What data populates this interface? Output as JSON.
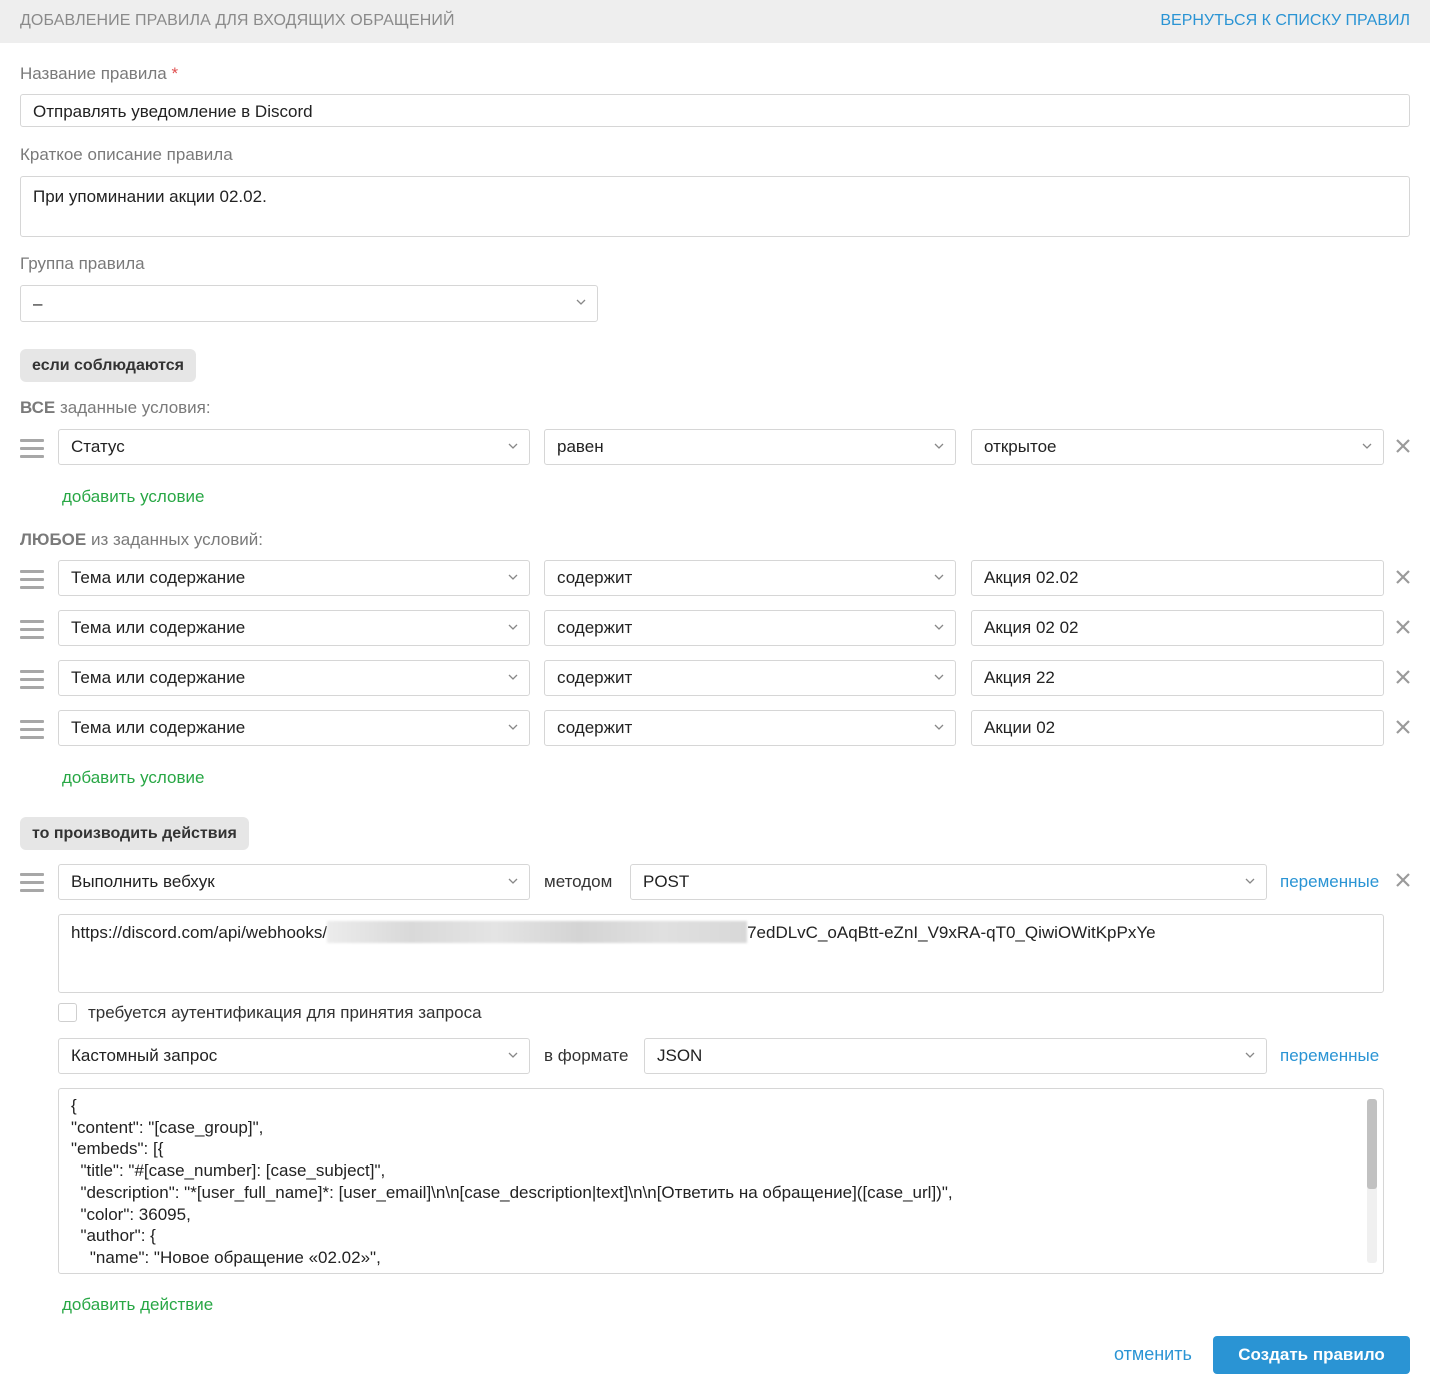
{
  "header": {
    "title": "ДОБАВЛЕНИЕ ПРАВИЛА ДЛЯ ВХОДЯЩИХ ОБРАЩЕНИЙ",
    "back_link": "ВЕРНУТЬСЯ К СПИСКУ ПРАВИЛ"
  },
  "form": {
    "name_label": "Название правила",
    "name_required_mark": "*",
    "name_value": "Отправлять уведомление в Discord",
    "description_label": "Краткое описание правила",
    "description_value": "При упоминании акции 02.02.",
    "group_label": "Группа правила",
    "group_value": "–"
  },
  "conditions": {
    "if_pill": "если соблюдаются",
    "all_title_bold": "ВСЕ",
    "all_title_rest": " заданные условия:",
    "all_rows": [
      {
        "field": "Статус",
        "operator": "равен",
        "value": "открытое"
      }
    ],
    "add_condition": "добавить условие",
    "any_title_bold": "ЛЮБОЕ",
    "any_title_rest": " из заданных условий:",
    "any_rows": [
      {
        "field": "Тема или содержание",
        "operator": "содержит",
        "value": "Акция 02.02"
      },
      {
        "field": "Тема или содержание",
        "operator": "содержит",
        "value": "Акция 02 02"
      },
      {
        "field": "Тема или содержание",
        "operator": "содержит",
        "value": "Акция 22"
      },
      {
        "field": "Тема или содержание",
        "operator": "содержит",
        "value": "Акции 02"
      }
    ]
  },
  "actions": {
    "then_pill": "то производить действия",
    "action_type": "Выполнить вебхук",
    "method_label": "методом",
    "method_value": "POST",
    "variables_link": "переменные",
    "url_prefix": "https://discord.com/api/webhooks/",
    "url_suffix": "7edDLvC_oAqBtt-eZnI_V9xRA-qT0_QiwiOWitKpPxYe",
    "auth_checkbox_label": "требуется аутентификация для принятия запроса",
    "auth_checked": false,
    "request_type": "Кастомный запрос",
    "format_label": "в формате",
    "format_value": "JSON",
    "body_lines": [
      "{",
      "\"content\": \"[case_group]\",",
      "\"embeds\": [{",
      "  \"title\": \"#[case_number]: [case_subject]\",",
      "  \"description\": \"*[user_full_name]*: [user_email]\\n\\n[case_description|text]\\n\\n[Ответить на обращение]([case_url])\",",
      "  \"color\": 36095,",
      "  \"author\": {",
      "    \"name\": \"Новое обращение «02.02»\","
    ],
    "add_action": "добавить действие"
  },
  "footer": {
    "cancel": "отменить",
    "create": "Создать правило"
  },
  "colors": {
    "accent_blue": "#2a94d4",
    "link_green": "#28a745",
    "required_red": "#e05050"
  }
}
